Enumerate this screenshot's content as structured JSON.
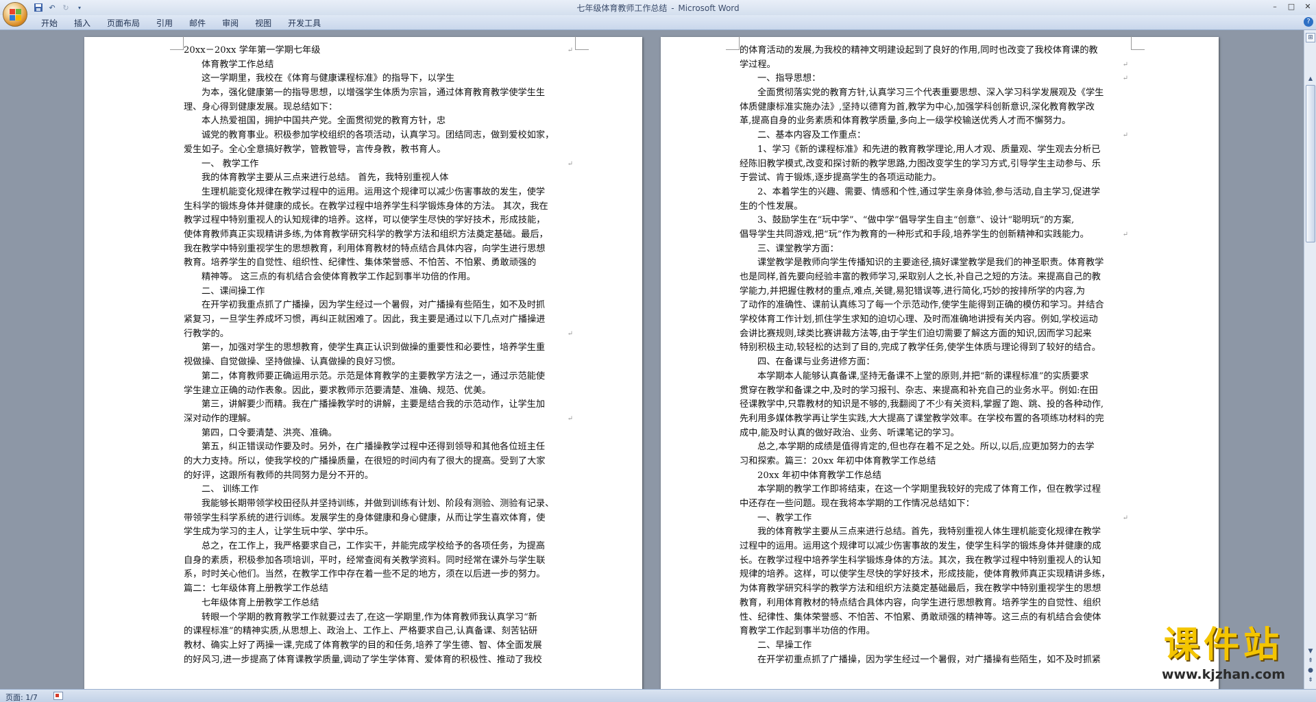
{
  "window": {
    "title": "七年级体育教师工作总结",
    "separator": "-",
    "app_name": "Microsoft Word",
    "controls": [
      "–",
      "□",
      "✕"
    ]
  },
  "quick_access": [
    "save-icon",
    "undo-icon",
    "redo-icon",
    "customize-icon"
  ],
  "ribbon": {
    "tabs": [
      "开始",
      "插入",
      "页面布局",
      "引用",
      "邮件",
      "审阅",
      "视图",
      "开发工具"
    ]
  },
  "pages": {
    "left": [
      {
        "text": "20xx－20xx 学年第一学期七年级",
        "indent": false,
        "mark": true
      },
      {
        "text": "体育教学工作总结",
        "indent": true,
        "mark": false
      },
      {
        "text": "这一学期里，我校在《体育与健康课程标准》的指导下，以学生",
        "indent": true,
        "mark": false
      },
      {
        "text": "为本，强化健康第一的指导思想，以增强学生体质为宗旨，通过体育教育教学使学生生",
        "indent": true,
        "mark": false
      },
      {
        "text": "理、身心得到健康发展。现总结如下：",
        "indent": false,
        "mark": false
      },
      {
        "text": "本人热爱祖国，拥护中国共产党。全面贯彻党的教育方针，忠",
        "indent": true,
        "mark": false
      },
      {
        "text": "诚党的教育事业。积极参加学校组织的各项活动，认真学习。团结同志，做到爱校如家，",
        "indent": true,
        "mark": false
      },
      {
        "text": "爱生如子。全心全意搞好教学，管教管导，言传身教，教书育人。",
        "indent": false,
        "mark": false
      },
      {
        "text": "一、 教学工作",
        "indent": true,
        "mark": true
      },
      {
        "text": "我的体育教学主要从三点来进行总结。 首先，我特别重视人体",
        "indent": true,
        "mark": false
      },
      {
        "text": "生理机能变化规律在教学过程中的运用。运用这个规律可以减少伤害事故的发生，使学",
        "indent": true,
        "mark": false
      },
      {
        "text": "生科学的锻炼身体并健康的成长。在教学过程中培养学生科学锻炼身体的方法。 其次，我在",
        "indent": false,
        "mark": false
      },
      {
        "text": "教学过程中特别重视人的认知规律的培养。这样，可以使学生尽快的学好技术，形成技能，",
        "indent": false,
        "mark": false
      },
      {
        "text": "使体育教师真正实现精讲多练,为体育教学研究科学的教学方法和组织方法奠定基础。最后，",
        "indent": false,
        "mark": false
      },
      {
        "text": "我在教学中特别重视学生的思想教育，利用体育教材的特点结合具体内容，向学生进行思想",
        "indent": false,
        "mark": false
      },
      {
        "text": "教育。培养学生的自觉性、组织性、纪律性、集体荣誉感、不怕苦、不怕累、勇敢顽强的",
        "indent": false,
        "mark": false
      },
      {
        "text": "精神等。 这三点的有机结合会使体育教学工作起到事半功倍的作用。",
        "indent": true,
        "mark": false
      },
      {
        "text": "二、课间操工作",
        "indent": true,
        "mark": false
      },
      {
        "text": "在开学初我重点抓了广播操，因为学生经过一个暑假，对广播操有些陌生，如不及时抓",
        "indent": true,
        "mark": false
      },
      {
        "text": "紧复习，一旦学生养成坏习惯，再纠正就困难了。因此，我主要是通过以下几点对广播操进",
        "indent": false,
        "mark": false
      },
      {
        "text": "行教学的。",
        "indent": false,
        "mark": true
      },
      {
        "text": "第一，加强对学生的思想教育，使学生真正认识到做操的重要性和必要性，培养学生重",
        "indent": true,
        "mark": false
      },
      {
        "text": "视做操、自觉做操、坚持做操、认真做操的良好习惯。",
        "indent": false,
        "mark": false
      },
      {
        "text": "第二，体育教师要正确运用示范。示范是体育教学的主要教学方法之一，通过示范能使",
        "indent": true,
        "mark": false
      },
      {
        "text": "学生建立正确的动作表象。因此，要求教师示范要清楚、准确、规范、优美。",
        "indent": false,
        "mark": false
      },
      {
        "text": "第三，讲解要少而精。我在广播操教学时的讲解，主要是结合我的示范动作，让学生加",
        "indent": true,
        "mark": false
      },
      {
        "text": "深对动作的理解。",
        "indent": false,
        "mark": true
      },
      {
        "text": "第四，口令要清楚、洪亮、准确。",
        "indent": true,
        "mark": false
      },
      {
        "text": "第五，纠正错误动作要及时。另外，在广播操教学过程中还得到领导和其他各位班主任",
        "indent": true,
        "mark": false
      },
      {
        "text": "的大力支持。所以，使我学校的广播操质量，在很短的时间内有了很大的提高。受到了大家",
        "indent": false,
        "mark": false
      },
      {
        "text": "的好评，这跟所有教师的共同努力是分不开的。",
        "indent": false,
        "mark": false
      },
      {
        "text": "二、 训练工作",
        "indent": true,
        "mark": false
      },
      {
        "text": "我能够长期带领学校田径队并坚持训练，并做到训练有计划、阶段有测验、测验有记录、",
        "indent": true,
        "mark": false
      },
      {
        "text": "带领学生科学系统的进行训练。发展学生的身体健康和身心健康，从而让学生喜欢体育，使",
        "indent": false,
        "mark": false
      },
      {
        "text": "学生成为学习的主人，让学生玩中学、学中乐。",
        "indent": false,
        "mark": false
      },
      {
        "text": "总之，在工作上，我严格要求自己，工作实干，并能完成学校给予的各项任务，为提高",
        "indent": true,
        "mark": false
      },
      {
        "text": "自身的素质，积极参加各项培训，平时，经常查阅有关教学资料。同时经常在课外与学生联",
        "indent": false,
        "mark": false
      },
      {
        "text": "系，时时关心他们。当然，在教学工作中存在着一些不足的地方，须在以后进一步的努力。",
        "indent": false,
        "mark": false
      },
      {
        "text": "篇二：七年级体育上册教学工作总结",
        "indent": false,
        "mark": false
      },
      {
        "text": "七年级体育上册教学工作总结",
        "indent": true,
        "mark": false
      },
      {
        "text": "转眼一个学期的教育教学工作就要过去了,在这一学期里,作为体育教师我认真学习“新",
        "indent": true,
        "mark": false
      },
      {
        "text": "的课程标准”的精神实质,从思想上、政治上、工作上、严格要求自己,认真备课、刻苦钻研",
        "indent": false,
        "mark": false
      },
      {
        "text": "教材、确实上好了两操一课,完成了体育教学的目的和任务,培养了学生德、智、体全面发展",
        "indent": false,
        "mark": false
      },
      {
        "text": "的好风习,进一步提高了体育课教学质量,调动了学生学体育、爱体育的积极性、推动了我校",
        "indent": false,
        "mark": false
      }
    ],
    "right": [
      {
        "text": "的体育活动的发展,为我校的精神文明建设起到了良好的作用,同时也改变了我校体育课的教",
        "indent": false,
        "mark": false
      },
      {
        "text": "学过程。",
        "indent": false,
        "mark": true
      },
      {
        "text": "一、指导思想：",
        "indent": true,
        "mark": true
      },
      {
        "text": "全面贯彻落实党的教育方针,认真学习三个代表重要思想、深入学习科学发展观及《学生",
        "indent": true,
        "mark": false
      },
      {
        "text": "体质健康标准实施办法》,坚持以德育为首,教学为中心,加强学科创新意识,深化教育教学改",
        "indent": false,
        "mark": false
      },
      {
        "text": "革,提高自身的业务素质和体育教学质量,多向上一级学校输送优秀人才而不懈努力。",
        "indent": false,
        "mark": false
      },
      {
        "text": "二、基本内容及工作重点：",
        "indent": true,
        "mark": true
      },
      {
        "text": "1、学习《新的课程标准》和先进的教育教学理论,用人才观、质量观、学生观去分析已",
        "indent": true,
        "mark": false
      },
      {
        "text": "经陈旧教学模式,改变和探讨新的教学思路,力图改变学生的学习方式,引导学生主动参与、乐",
        "indent": false,
        "mark": false
      },
      {
        "text": "于尝试、肯于锻炼,逐步提高学生的各项运动能力。",
        "indent": false,
        "mark": false
      },
      {
        "text": "2、本着学生的兴趣、需要、情感和个性,通过学生亲身体验,参与活动,自主学习,促进学",
        "indent": true,
        "mark": false
      },
      {
        "text": "生的个性发展。",
        "indent": false,
        "mark": false
      },
      {
        "text": "3、鼓励学生在“玩中学”、“做中学”倡导学生自主“创意”、设计“聪明玩”的方案,",
        "indent": true,
        "mark": false
      },
      {
        "text": "倡导学生共同游戏,把“玩”作为教育的一种形式和手段,培养学生的创新精神和实践能力。",
        "indent": false,
        "mark": true
      },
      {
        "text": "三、课堂教学方面：",
        "indent": true,
        "mark": false
      },
      {
        "text": "课堂教学是教师向学生传播知识的主要途径,搞好课堂教学是我们的神圣职责。体育教学",
        "indent": true,
        "mark": false
      },
      {
        "text": "也是同样,首先要向经验丰富的教师学习,采取别人之长,补自己之短的方法。来提高自己的教",
        "indent": false,
        "mark": false
      },
      {
        "text": "学能力,并把握住教材的重点,难点,关键,易犯错误等,进行简化,巧妙的按排所学的内容,为",
        "indent": false,
        "mark": false
      },
      {
        "text": "了动作的准确性、课前认真练习了每一个示范动作,使学生能得到正确的模仿和学习。并结合",
        "indent": false,
        "mark": false
      },
      {
        "text": "学校体育工作计划,抓住学生求知的迫切心理、及时而准确地讲授有关内容。例如,学校运动",
        "indent": false,
        "mark": false
      },
      {
        "text": "会讲比赛规则,球类比赛讲裁方法等,由于学生们迫切需要了解这方面的知识,因而学习起来",
        "indent": false,
        "mark": false
      },
      {
        "text": "特别积极主动,较轻松的达到了目的,完成了教学任务,使学生体质与理论得到了较好的结合。",
        "indent": false,
        "mark": false
      },
      {
        "text": "四、在备课与业务进修方面：",
        "indent": true,
        "mark": false
      },
      {
        "text": "本学期本人能够认真备课,坚持无备课不上堂的原则,并把“新的课程标准”的实质要求",
        "indent": true,
        "mark": false
      },
      {
        "text": "贯穿在教学和备课之中,及时的学习报刊、杂志、来提高和补充自己的业务水平。例如:在田",
        "indent": false,
        "mark": false
      },
      {
        "text": "径课教学中,只靠教材的知识是不够的,我翻阅了不少有关资料,掌握了跑、跳、投的各种动作,",
        "indent": false,
        "mark": false
      },
      {
        "text": "先利用多媒体教学再让学生实践,大大提高了课堂教学效率。在学校布置的各项练功材料的完",
        "indent": false,
        "mark": false
      },
      {
        "text": "成中,能及时认真的做好政治、业务、听课笔记的学习。",
        "indent": false,
        "mark": false
      },
      {
        "text": "总之,本学期的成绩是值得肯定的,但也存在着不足之处。所以,以后,应更加努力的去学",
        "indent": true,
        "mark": false
      },
      {
        "text": "习和探索。篇三：20xx 年初中体育教学工作总结",
        "indent": false,
        "mark": false
      },
      {
        "text": "20xx 年初中体育教学工作总结",
        "indent": true,
        "mark": false
      },
      {
        "text": "本学期的教学工作即将结束，在这一个学期里我较好的完成了体育工作，但在教学过程",
        "indent": true,
        "mark": false
      },
      {
        "text": "中还存在一些问题。现在我将本学期的工作情况总结如下：",
        "indent": false,
        "mark": false
      },
      {
        "text": "一、教学工作",
        "indent": true,
        "mark": true
      },
      {
        "text": "我的体育教学主要从三点来进行总结。首先，我特别重视人体生理机能变化规律在教学",
        "indent": true,
        "mark": false
      },
      {
        "text": "过程中的运用。运用这个规律可以减少伤害事故的发生，使学生科学的锻炼身体并健康的成",
        "indent": false,
        "mark": false
      },
      {
        "text": "长。在教学过程中培养学生科学锻炼身体的方法。其次，我在教学过程中特别重视人的认知",
        "indent": false,
        "mark": false
      },
      {
        "text": "规律的培养。这样，可以使学生尽快的学好技术，形成技能，使体育教师真正实现精讲多练，",
        "indent": false,
        "mark": false
      },
      {
        "text": "为体育教学研究科学的教学方法和组织方法奠定基础最后，我在教学中特别重视学生的思想",
        "indent": false,
        "mark": false
      },
      {
        "text": "教育，利用体育教材的特点结合具体内容，向学生进行思想教育。培养学生的自觉性、组织",
        "indent": false,
        "mark": false
      },
      {
        "text": "性、纪律性、集体荣誉感、不怕苦、不怕累、勇敢顽强的精神等。这三点的有机结合会使体",
        "indent": false,
        "mark": false
      },
      {
        "text": "育教学工作起到事半功倍的作用。",
        "indent": false,
        "mark": false
      },
      {
        "text": "二、早操工作",
        "indent": true,
        "mark": false
      },
      {
        "text": "在开学初重点抓了广播操，因为学生经过一个暑假，对广播操有些陌生，如不及时抓紧",
        "indent": true,
        "mark": false
      }
    ]
  },
  "paragraph_mark": "↵",
  "status": {
    "page_count": "页面: 1/7"
  },
  "watermark": {
    "title": "课件站",
    "url": "www.kjzhan.com"
  },
  "colors": {
    "watermark_title": "#f4c500",
    "ribbon_bg": "#c9d7eb",
    "doc_bg": "#8d97a6"
  }
}
